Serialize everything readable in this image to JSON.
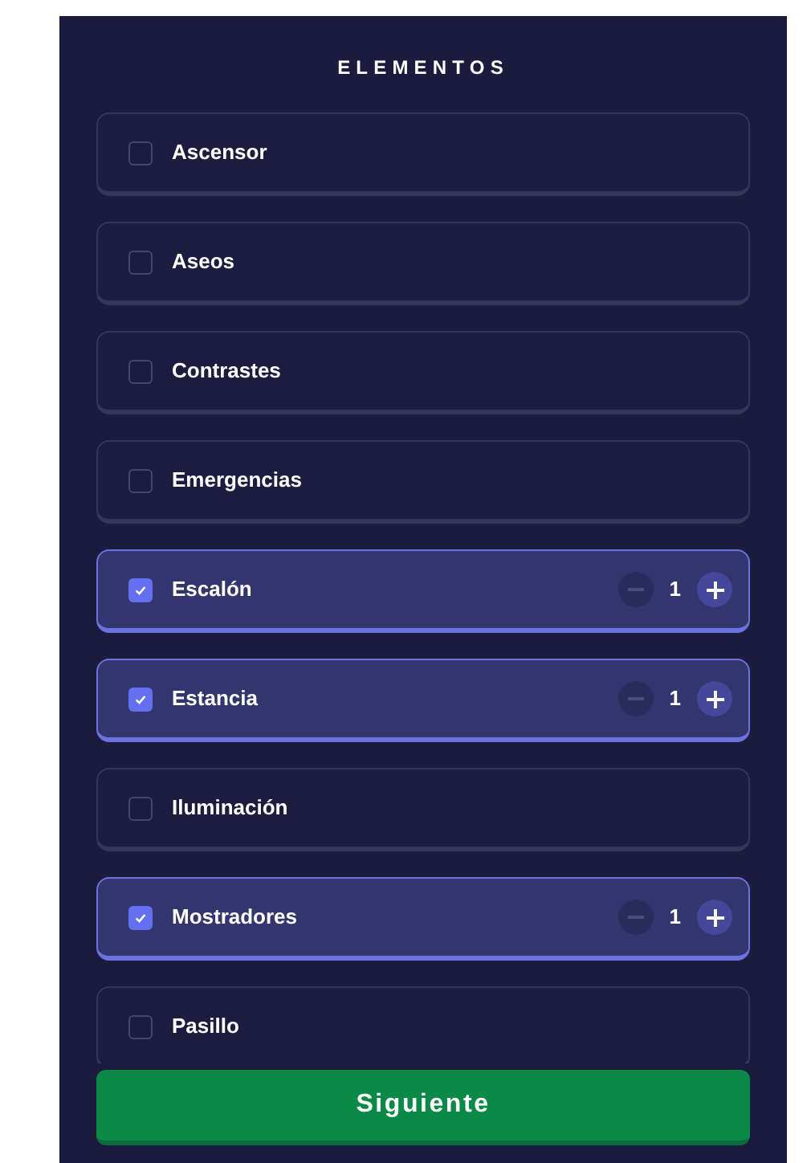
{
  "title": "ELEMENTOS",
  "items": [
    {
      "label": "Ascensor",
      "checked": false
    },
    {
      "label": "Aseos",
      "checked": false
    },
    {
      "label": "Contrastes",
      "checked": false
    },
    {
      "label": "Emergencias",
      "checked": false
    },
    {
      "label": "Escalón",
      "checked": true,
      "count": "1"
    },
    {
      "label": "Estancia",
      "checked": true,
      "count": "1"
    },
    {
      "label": "Iluminación",
      "checked": false
    },
    {
      "label": "Mostradores",
      "checked": true,
      "count": "1"
    },
    {
      "label": "Pasillo",
      "checked": false
    }
  ],
  "next_button": "Siguiente"
}
